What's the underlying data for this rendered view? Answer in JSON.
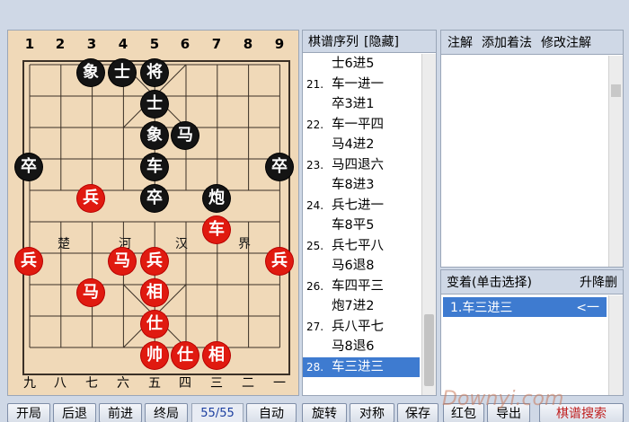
{
  "board": {
    "top_files": [
      "1",
      "2",
      "3",
      "4",
      "5",
      "6",
      "7",
      "8",
      "9"
    ],
    "bottom_files": [
      "九",
      "八",
      "七",
      "六",
      "五",
      "四",
      "三",
      "二",
      "一"
    ],
    "river": [
      "楚",
      "河",
      "汉",
      "界"
    ],
    "pieces": [
      {
        "label": "象",
        "side": "black"
      },
      {
        "label": "士",
        "side": "black"
      },
      {
        "label": "将",
        "side": "black"
      },
      {
        "label": "士",
        "side": "black"
      },
      {
        "label": "象",
        "side": "black"
      },
      {
        "label": "马",
        "side": "black"
      },
      {
        "label": "卒",
        "side": "black"
      },
      {
        "label": "车",
        "side": "black"
      },
      {
        "label": "卒",
        "side": "black"
      },
      {
        "label": "卒",
        "side": "black"
      },
      {
        "label": "炮",
        "side": "black"
      },
      {
        "label": "兵",
        "side": "red"
      },
      {
        "label": "车",
        "side": "red"
      },
      {
        "label": "兵",
        "side": "red"
      },
      {
        "label": "马",
        "side": "red"
      },
      {
        "label": "兵",
        "side": "red"
      },
      {
        "label": "兵",
        "side": "red"
      },
      {
        "label": "马",
        "side": "red"
      },
      {
        "label": "相",
        "side": "red"
      },
      {
        "label": "仕",
        "side": "red"
      },
      {
        "label": "帅",
        "side": "red"
      },
      {
        "label": "仕",
        "side": "red"
      },
      {
        "label": "相",
        "side": "red"
      }
    ]
  },
  "moves": {
    "header_title": "棋谱序列",
    "header_toggle": "[隐藏]",
    "rows": [
      {
        "num": "",
        "text": "士6进5"
      },
      {
        "num": "21.",
        "text": "车一进一"
      },
      {
        "num": "",
        "text": "卒3进1"
      },
      {
        "num": "22.",
        "text": "车一平四"
      },
      {
        "num": "",
        "text": "马4进2"
      },
      {
        "num": "23.",
        "text": "马四退六"
      },
      {
        "num": "",
        "text": "车8进3"
      },
      {
        "num": "24.",
        "text": "兵七进一"
      },
      {
        "num": "",
        "text": "车8平5"
      },
      {
        "num": "25.",
        "text": "兵七平八"
      },
      {
        "num": "",
        "text": "马6退8"
      },
      {
        "num": "26.",
        "text": "车四平三"
      },
      {
        "num": "",
        "text": "炮7进2"
      },
      {
        "num": "27.",
        "text": "兵八平七"
      },
      {
        "num": "",
        "text": "马8退6"
      },
      {
        "num": "28.",
        "text": "车三进三"
      }
    ]
  },
  "notes": {
    "comment_tab": "注解",
    "add_move_tab": "添加着法",
    "edit_comment_tab": "修改注解"
  },
  "variations": {
    "title": "变着(单击选择)",
    "reorder": "升降删",
    "item": "1.车三进三",
    "item_arrow": "<一"
  },
  "toolbar": {
    "open": "开局",
    "back": "后退",
    "forward": "前进",
    "end": "终局",
    "counter": "55/55",
    "auto": "自动",
    "rotate": "旋转",
    "mirror": "对称",
    "save": "保存",
    "redpack": "红包",
    "export": "导出",
    "search": "棋谱搜索"
  },
  "watermark": "Downyi.com",
  "colors": {
    "board": "#f0d9b8",
    "red_piece": "#e01a10",
    "black_piece": "#141414",
    "selection": "#3e7bd0",
    "chrome": "#cfd8e6"
  }
}
